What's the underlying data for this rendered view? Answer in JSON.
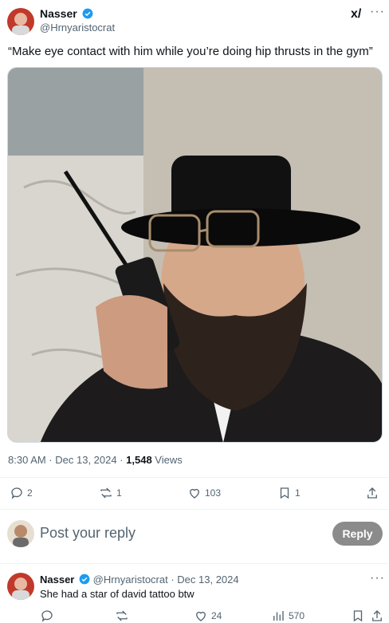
{
  "tweet": {
    "display_name": "Nasser",
    "handle": "@Hrnyaristocrat",
    "text": "“Make eye contact with him while you’re doing hip thrusts in the gym”",
    "time": "8:30 AM · Dec 13, 2024 · ",
    "views_count": "1,548",
    "views_label": " Views",
    "stats": {
      "replies": "2",
      "retweets": "1",
      "likes": "103",
      "bookmarks": "1"
    }
  },
  "composer": {
    "placeholder": "Post your reply",
    "button": "Reply"
  },
  "reply": {
    "display_name": "Nasser",
    "handle_date": "@Hrnyaristocrat · Dec 13, 2024",
    "text": "She had a star of david tattoo btw",
    "stats": {
      "likes": "24",
      "views": "570"
    }
  },
  "colors": {
    "verified": "#1d9bf0",
    "muted": "#536471",
    "divider": "#eff3f4"
  }
}
